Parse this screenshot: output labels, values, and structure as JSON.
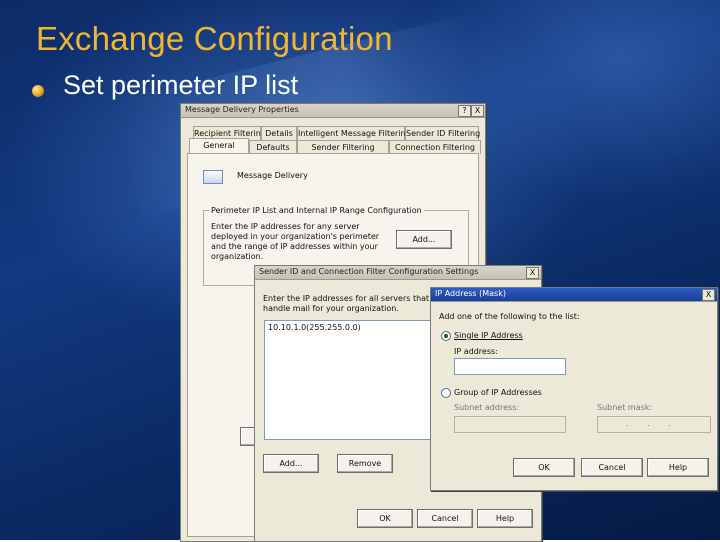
{
  "slide": {
    "title": "Exchange Configuration",
    "bullet": "Set perimeter IP list"
  },
  "msg_dialog": {
    "title": "Message Delivery Properties",
    "help_btn": "?",
    "close_btn": "X",
    "tabs_row1": [
      "Recipient Filtering",
      "Details",
      "Intelligent Message Filtering",
      "Sender ID Filtering"
    ],
    "tabs_row2": [
      "General",
      "Defaults",
      "Sender Filtering",
      "Connection Filtering"
    ],
    "header_label": "Message Delivery",
    "group_title": "Perimeter IP List and Internal IP Range Configuration",
    "group_text": "Enter the IP addresses for any server deployed in your organization's perimeter and the range of IP addresses within your organization.",
    "add_btn": "Add..."
  },
  "sender_dialog": {
    "title": "Sender ID and Connection Filter Configuration Settings",
    "close_btn": "X",
    "instruction": "Enter the IP addresses for all servers that handle mail for your organization.",
    "list_items": [
      "10.10.1.0(255.255.0.0)"
    ],
    "add_btn": "Add...",
    "remove_btn": "Remove",
    "ok_btn": "OK",
    "cancel_btn": "Cancel",
    "help_btn": "Help"
  },
  "ip_dialog": {
    "title": "IP Address (Mask)",
    "close_btn": "X",
    "prompt": "Add one of the following to the list:",
    "single_label": "Single IP Address",
    "ip_address_label": "IP address:",
    "group_label": "Group of IP Addresses",
    "subnet_label": "Subnet address:",
    "mask_label": "Subnet mask:",
    "mask_value": ". . .",
    "ok_btn": "OK",
    "cancel_btn": "Cancel",
    "help_btn": "Help",
    "selected_option": "single"
  }
}
